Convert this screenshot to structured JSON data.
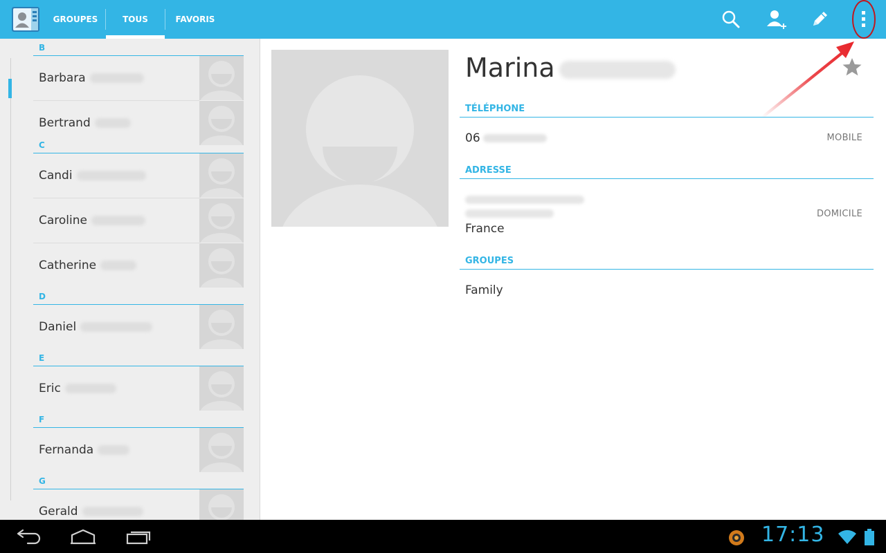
{
  "actionbar": {
    "tabs": [
      {
        "label": "GROUPES"
      },
      {
        "label": "TOUS"
      },
      {
        "label": "FAVORIS"
      }
    ],
    "active_tab": "TOUS",
    "actions": [
      "search-icon",
      "add-contact-icon",
      "edit-icon",
      "overflow-menu-icon"
    ]
  },
  "contacts": {
    "sections": [
      {
        "letter": "B",
        "items": [
          "Barbara",
          "Bertrand"
        ]
      },
      {
        "letter": "C",
        "items": [
          "Candi",
          "Caroline",
          "Catherine"
        ]
      },
      {
        "letter": "D",
        "items": [
          "Daniel"
        ]
      },
      {
        "letter": "E",
        "items": [
          "Eric"
        ]
      },
      {
        "letter": "F",
        "items": [
          "Fernanda"
        ]
      },
      {
        "letter": "G",
        "items": [
          "Gerald"
        ]
      }
    ]
  },
  "detail": {
    "first_name": "Marina",
    "phone": {
      "heading": "TÉLÉPHONE",
      "prefix": "06",
      "type": "MOBILE"
    },
    "address": {
      "heading": "ADRESSE",
      "country": "France",
      "type": "DOMICILE"
    },
    "groups": {
      "heading": "GROUPES",
      "value": "Family"
    }
  },
  "status": {
    "time": "17:13"
  },
  "colors": {
    "accent": "#33b5e5",
    "annotation": "#e8262b"
  }
}
